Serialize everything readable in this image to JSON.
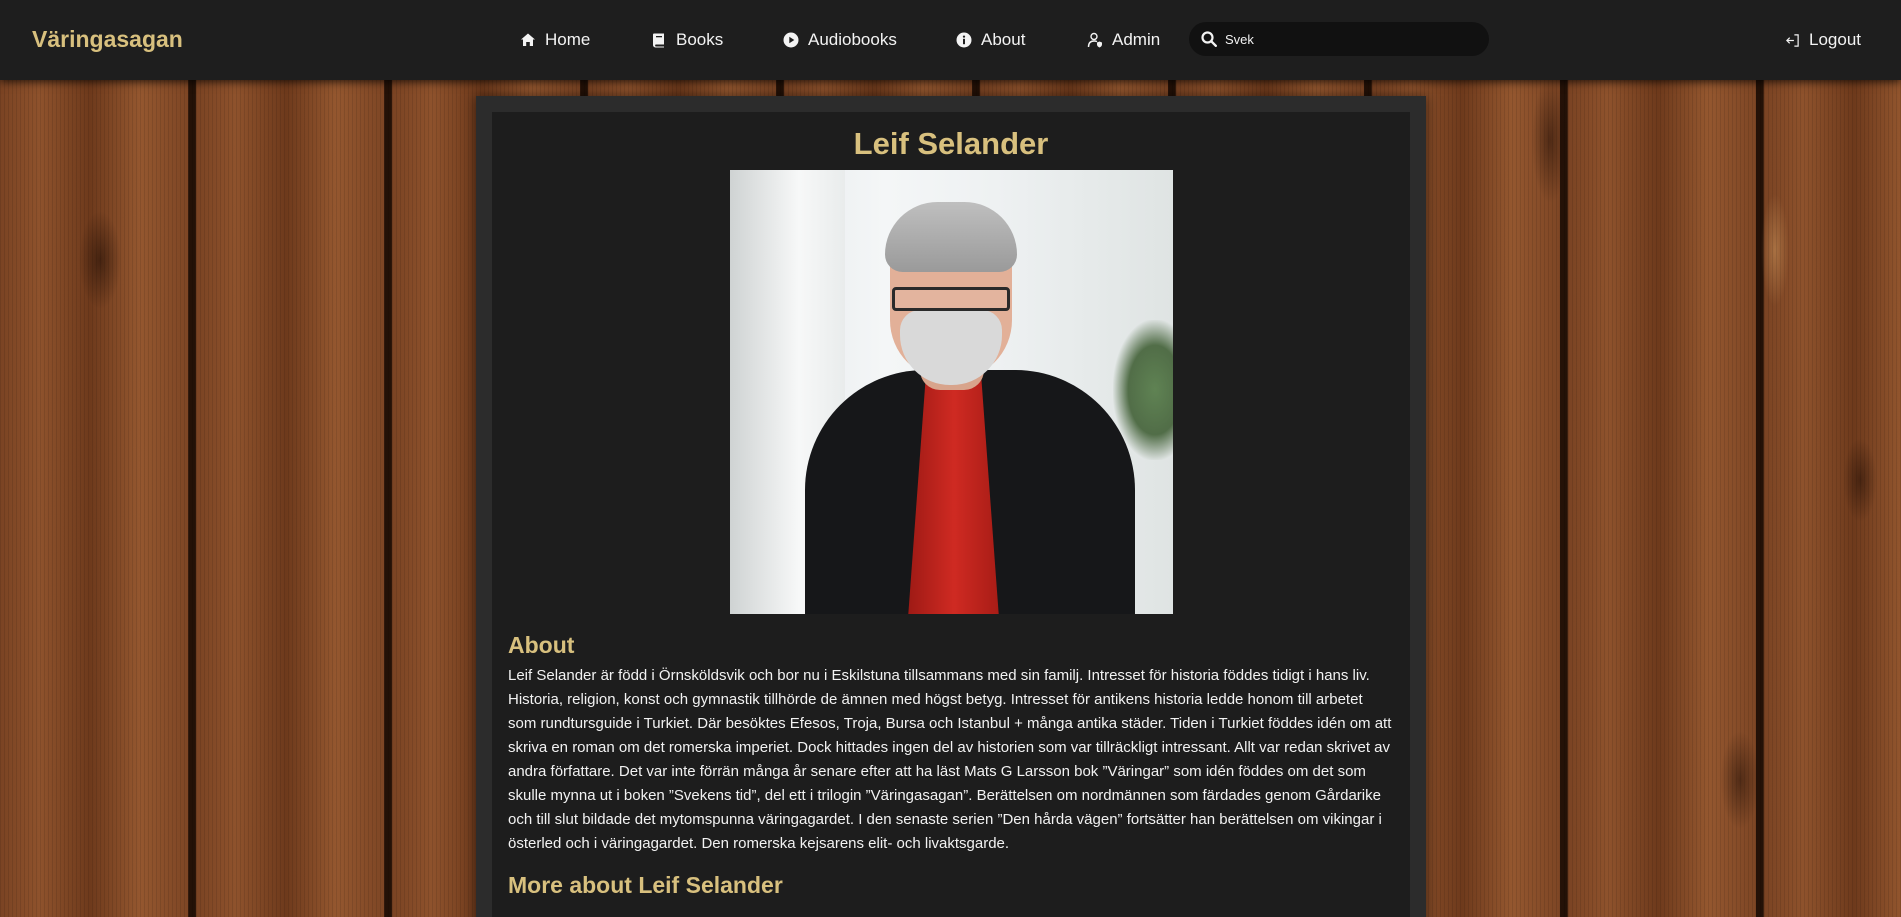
{
  "navbar": {
    "brand": "Väringasagan",
    "items": [
      {
        "label": "Home",
        "icon": "home-icon"
      },
      {
        "label": "Books",
        "icon": "book-icon"
      },
      {
        "label": "Audiobooks",
        "icon": "play-circle-icon"
      },
      {
        "label": "About",
        "icon": "info-circle-icon"
      },
      {
        "label": "Admin",
        "icon": "user-shield-icon"
      }
    ],
    "search": {
      "value": "Svek",
      "placeholder": "",
      "icon": "search-icon"
    },
    "logout": {
      "label": "Logout",
      "icon": "logout-icon"
    }
  },
  "author": {
    "name": "Leif Selander",
    "portrait_alt": "Leif Selander"
  },
  "about": {
    "heading": "About",
    "text": "Leif Selander är född i Örnsköldsvik och bor nu i Eskilstuna tillsammans med sin familj. Intresset för historia föddes tidigt i hans liv. Historia, religion, konst och gymnastik tillhörde de ämnen med högst betyg. Intresset för antikens historia ledde honom till arbetet som rundtursguide i Turkiet. Där besöktes Efesos, Troja, Bursa och Istanbul + många antika städer. Tiden i Turkiet föddes idén om att skriva en roman om det romerska imperiet. Dock hittades ingen del av historien som var tillräckligt intressant. Allt var redan skrivet av andra författare. Det var inte förrän många år senare efter att ha läst Mats G Larsson bok ”Väringar” som idén föddes om det som skulle mynna ut i boken ”Svekens tid”, del ett i trilogin ”Väringasagan”. Berättelsen om nordmännen som färdades genom Gårdarike och till slut bildade det mytomspunna väringagardet. I den senaste serien ”Den hårda vägen” fortsätter han berättelsen om vikingar i österled och i väringagardet. Den romerska kejsarens elit- och livaktsgarde."
  },
  "more": {
    "heading": "More about Leif Selander"
  },
  "colors": {
    "accent": "#d8c07e",
    "navbar_bg": "#1e1e1e",
    "card_bg": "#1d1d1d",
    "card_border": "#2c2c2c",
    "text": "#f2f2f2"
  }
}
